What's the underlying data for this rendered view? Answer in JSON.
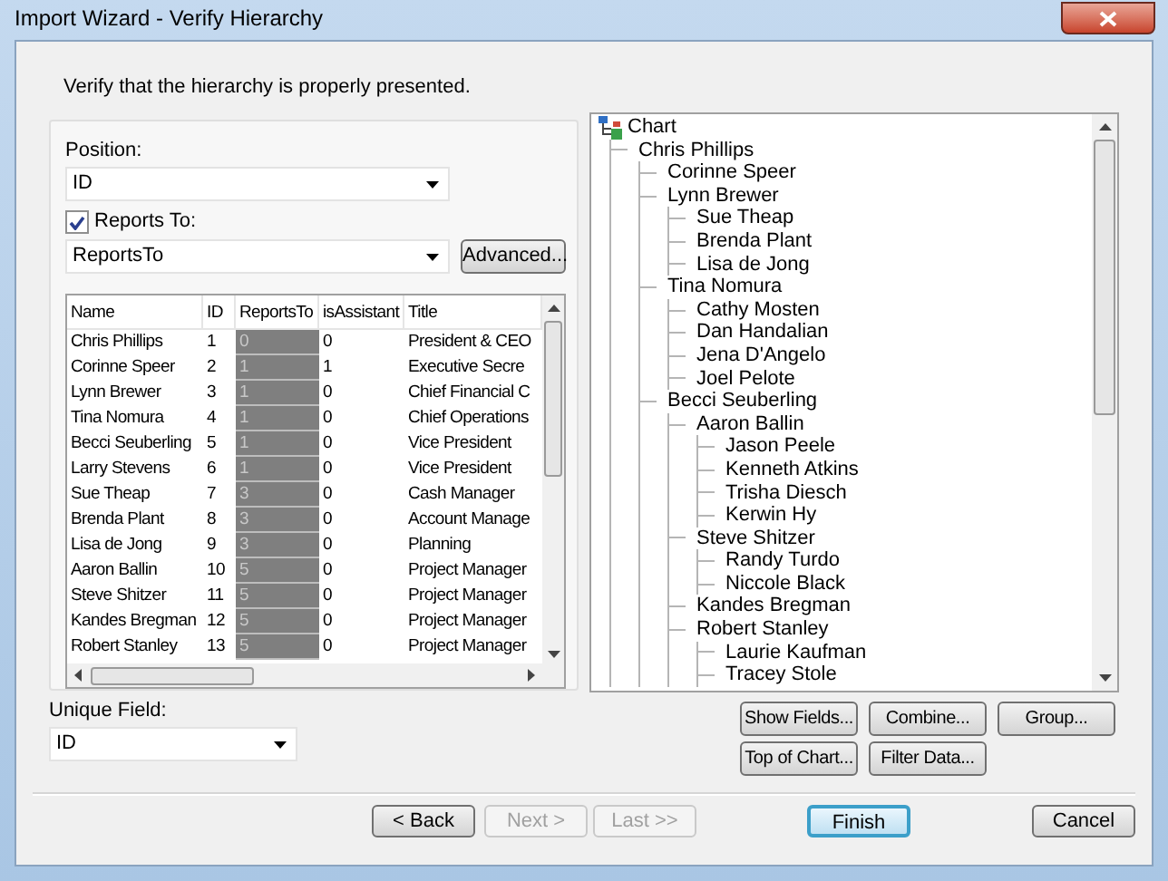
{
  "window": {
    "title": "Import Wizard - Verify Hierarchy"
  },
  "instruction": "Verify that the hierarchy is properly presented.",
  "position": {
    "label": "Position:",
    "value": "ID"
  },
  "reports_to": {
    "label": "Reports To:",
    "checked": true,
    "value": "ReportsTo",
    "button": "Advanced..."
  },
  "table": {
    "columns": [
      {
        "label": "Name",
        "selected": false
      },
      {
        "label": "ID",
        "selected": false
      },
      {
        "label": "ReportsTo",
        "selected": true
      },
      {
        "label": "isAssistant",
        "selected": false
      },
      {
        "label": "Title",
        "selected": false
      }
    ],
    "rows": [
      [
        "Chris Phillips",
        "1",
        "0",
        "0",
        "President & CEO"
      ],
      [
        "Corinne Speer",
        "2",
        "1",
        "1",
        "Executive Secre"
      ],
      [
        "Lynn Brewer",
        "3",
        "1",
        "0",
        "Chief Financial C"
      ],
      [
        "Tina Nomura",
        "4",
        "1",
        "0",
        "Chief Operations"
      ],
      [
        "Becci Seuberling",
        "5",
        "1",
        "0",
        "Vice President"
      ],
      [
        "Larry Stevens",
        "6",
        "1",
        "0",
        "Vice President"
      ],
      [
        "Sue Theap",
        "7",
        "3",
        "0",
        "Cash Manager"
      ],
      [
        "Brenda Plant",
        "8",
        "3",
        "0",
        "Account Manage"
      ],
      [
        "Lisa de Jong",
        "9",
        "3",
        "0",
        "Planning"
      ],
      [
        "Aaron Ballin",
        "10",
        "5",
        "0",
        "Project Manager"
      ],
      [
        "Steve Shitzer",
        "11",
        "5",
        "0",
        "Project Manager"
      ],
      [
        "Kandes Bregman",
        "12",
        "5",
        "0",
        "Project Manager"
      ],
      [
        "Robert Stanley",
        "13",
        "5",
        "0",
        "Project Manager"
      ]
    ]
  },
  "tree": {
    "label": "Chart",
    "children": [
      {
        "label": "Chris Phillips",
        "children": [
          {
            "label": "Corinne Speer"
          },
          {
            "label": "Lynn Brewer",
            "children": [
              {
                "label": "Sue Theap"
              },
              {
                "label": "Brenda Plant"
              },
              {
                "label": "Lisa de Jong"
              }
            ]
          },
          {
            "label": "Tina Nomura",
            "children": [
              {
                "label": "Cathy Mosten"
              },
              {
                "label": "Dan Handalian"
              },
              {
                "label": "Jena D'Angelo"
              },
              {
                "label": "Joel Pelote"
              }
            ]
          },
          {
            "label": "Becci Seuberling",
            "children": [
              {
                "label": "Aaron Ballin",
                "children": [
                  {
                    "label": "Jason Peele"
                  },
                  {
                    "label": "Kenneth Atkins"
                  },
                  {
                    "label": "Trisha Diesch"
                  },
                  {
                    "label": "Kerwin Hy"
                  }
                ]
              },
              {
                "label": "Steve Shitzer",
                "children": [
                  {
                    "label": "Randy Turdo"
                  },
                  {
                    "label": "Niccole Black"
                  }
                ]
              },
              {
                "label": "Kandes Bregman"
              },
              {
                "label": "Robert Stanley",
                "children": [
                  {
                    "label": "Laurie Kaufman"
                  },
                  {
                    "label": "Tracey Stole"
                  }
                ]
              }
            ]
          }
        ]
      }
    ]
  },
  "tree_buttons": [
    [
      "Show Fields...",
      "Combine...",
      "Group..."
    ],
    [
      "Top of Chart...",
      "Filter Data..."
    ]
  ],
  "unique_field": {
    "label": "Unique Field:",
    "value": "ID"
  },
  "nav_buttons": [
    {
      "label": "< Back",
      "disabled": false,
      "default": false
    },
    {
      "label": "Next >",
      "disabled": true,
      "default": false
    },
    {
      "label": "Last >>",
      "disabled": true,
      "default": false
    },
    {
      "label": "Finish",
      "disabled": false,
      "default": true
    },
    {
      "label": "Cancel",
      "disabled": false,
      "default": false
    }
  ]
}
